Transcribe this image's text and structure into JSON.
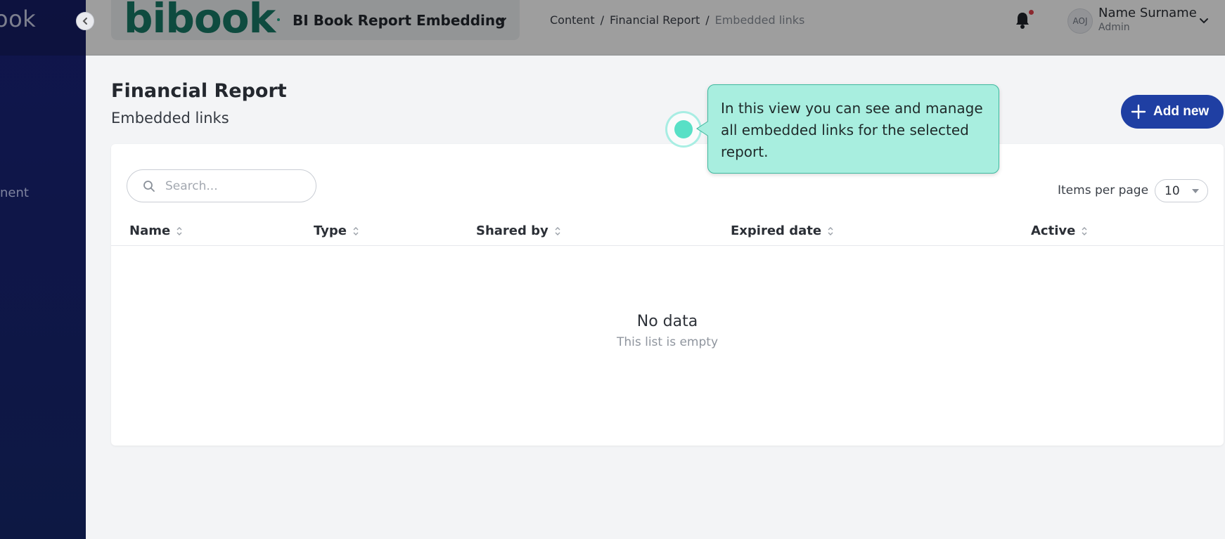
{
  "sidebar": {
    "brand": "ook",
    "items": [
      {
        "label": "nent"
      }
    ],
    "collapse_icon": "chevron-left-icon"
  },
  "header": {
    "logo_text": "bibook",
    "app_name": "BI Book Report Embedding",
    "breadcrumb": [
      "Content",
      "Financial Report",
      "Embedded links"
    ],
    "notifications_icon": "bell-icon",
    "user": {
      "initials": "AOJ",
      "name": "Name Surname",
      "role": "Admin"
    }
  },
  "page": {
    "title": "Financial Report",
    "subtitle": "Embedded links",
    "add_button_label": "Add new"
  },
  "table": {
    "search_placeholder": "Search...",
    "items_per_page_label": "Items per page",
    "items_per_page_value": "10",
    "columns": [
      "Name",
      "Type",
      "Shared by",
      "Expired date",
      "Active"
    ],
    "empty_title": "No data",
    "empty_subtitle": "This list is empty"
  },
  "tour": {
    "text": "In this view you can see and manage all embedded links for the selected report."
  },
  "colors": {
    "sidebar": "#161d66",
    "primary_button": "#1f3fa3",
    "logo": "#177a66",
    "tooltip_bg": "#a8eedf",
    "beacon": "#58e0c6"
  }
}
